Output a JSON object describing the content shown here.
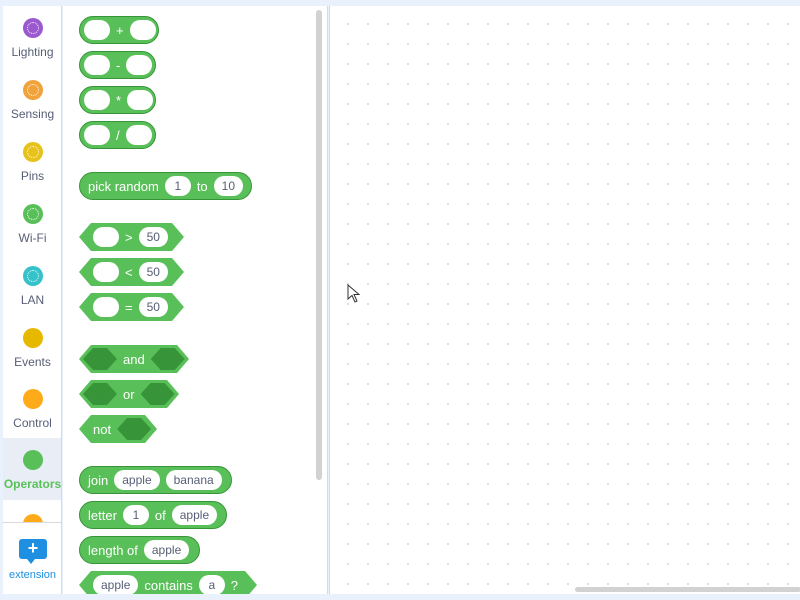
{
  "categories": [
    {
      "label": "Lighting",
      "color": "#9b59d0",
      "icon": "lighting-icon",
      "ring": true
    },
    {
      "label": "Sensing",
      "color": "#f0a33a",
      "icon": "sensing-icon",
      "ring": true
    },
    {
      "label": "Pins",
      "color": "#e6c21a",
      "icon": "pins-icon",
      "ring": true
    },
    {
      "label": "Wi-Fi",
      "color": "#59c059",
      "icon": "wifi-icon",
      "ring": true
    },
    {
      "label": "LAN",
      "color": "#35c3c9",
      "icon": "lan-icon",
      "ring": true
    },
    {
      "label": "Events",
      "color": "#e6b800",
      "icon": "events-icon",
      "ring": false
    },
    {
      "label": "Control",
      "color": "#ffab19",
      "icon": "control-icon",
      "ring": false
    },
    {
      "label": "Operators",
      "color": "#59c059",
      "icon": "operators-icon",
      "ring": false,
      "selected": true
    }
  ],
  "extension": {
    "label": "extension",
    "icon_glyph": "+"
  },
  "blocks": {
    "add_op": "+",
    "sub_op": "-",
    "mul_op": "*",
    "div_op": "/",
    "random": {
      "pick": "pick random",
      "from": "1",
      "to_word": "to",
      "to": "10"
    },
    "gt": {
      "op": ">",
      "value": "50"
    },
    "lt": {
      "op": "<",
      "value": "50"
    },
    "eq": {
      "op": "=",
      "value": "50"
    },
    "and_word": "and",
    "or_word": "or",
    "not_word": "not",
    "join": {
      "word": "join",
      "a": "apple",
      "b": "banana"
    },
    "letter": {
      "word": "letter",
      "index": "1",
      "of_word": "of",
      "text": "apple"
    },
    "length": {
      "word": "length of",
      "text": "apple"
    },
    "contains": {
      "text": "apple",
      "word": "contains",
      "value": "a",
      "q": "?"
    }
  },
  "colors": {
    "operators": "#59c059",
    "operators_dark": "#389438",
    "extension": "#1e8fe1"
  }
}
